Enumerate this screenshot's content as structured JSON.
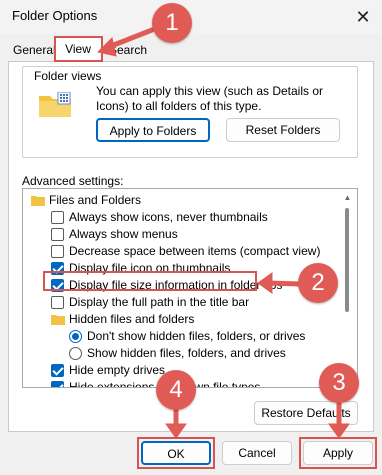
{
  "window": {
    "title": "Folder Options",
    "close_glyph": "✕"
  },
  "tabs": [
    {
      "label": "General"
    },
    {
      "label": "View"
    },
    {
      "label": "Search"
    }
  ],
  "folder_views": {
    "group_label": "Folder views",
    "description": "You can apply this view (such as Details or Icons) to all folders of this type.",
    "apply_button": "Apply to Folders",
    "reset_button": "Reset Folders"
  },
  "advanced": {
    "label": "Advanced settings:",
    "rows": [
      {
        "kind": "folder",
        "label": "Files and Folders"
      },
      {
        "kind": "checkbox",
        "checked": false,
        "label": "Always show icons, never thumbnails"
      },
      {
        "kind": "checkbox",
        "checked": false,
        "label": "Always show menus"
      },
      {
        "kind": "checkbox",
        "checked": false,
        "label": "Decrease space between items (compact view)"
      },
      {
        "kind": "checkbox",
        "checked": true,
        "label": "Display file icon on thumbnails"
      },
      {
        "kind": "checkbox",
        "checked": true,
        "label": "Display file size information in folder tips"
      },
      {
        "kind": "checkbox",
        "checked": false,
        "label": "Display the full path in the title bar"
      },
      {
        "kind": "folder",
        "label": "Hidden files and folders"
      },
      {
        "kind": "radio",
        "checked": true,
        "label": "Don't show hidden files, folders, or drives"
      },
      {
        "kind": "radio",
        "checked": false,
        "label": "Show hidden files, folders, and drives"
      },
      {
        "kind": "checkbox",
        "checked": true,
        "label": "Hide empty drives"
      },
      {
        "kind": "checkbox",
        "checked": true,
        "label": "Hide extensions for known file types"
      }
    ]
  },
  "buttons": {
    "restore": "Restore Defaults",
    "ok": "OK",
    "cancel": "Cancel",
    "apply": "Apply"
  },
  "callouts": [
    "1",
    "2",
    "3",
    "4"
  ],
  "colors": {
    "accent": "#0067c0",
    "callout": "#e05b55"
  }
}
